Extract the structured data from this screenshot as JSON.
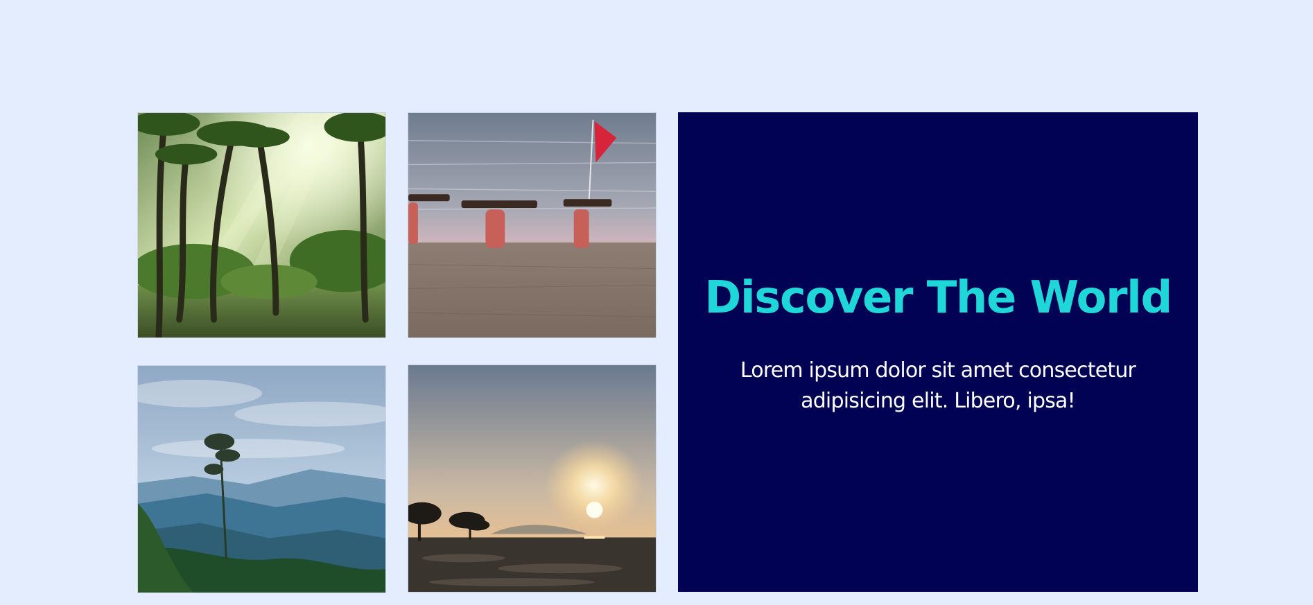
{
  "hero": {
    "title": "Discover The World",
    "text": "Lorem ipsum dolor sit amet consectetur adipisicing elit. Libero, ipsa!"
  },
  "colors": {
    "page_background": "#e4edfe",
    "panel_background": "#020254",
    "title_accent": "#1fd6d9",
    "body_text": "#ffffff"
  },
  "gallery": [
    {
      "name": "photo-jungle",
      "subject": "palm forest with sun rays"
    },
    {
      "name": "photo-beach",
      "subject": "people carrying wood on a beach with a red flag"
    },
    {
      "name": "photo-mountain",
      "subject": "misty blue mountains with a tall tree"
    },
    {
      "name": "photo-sunset",
      "subject": "sunset over a tidal flat with trees"
    }
  ]
}
